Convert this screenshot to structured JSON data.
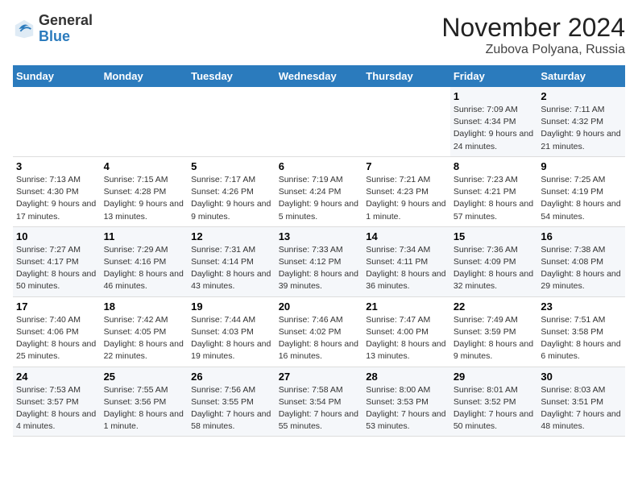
{
  "logo": {
    "general": "General",
    "blue": "Blue"
  },
  "header": {
    "month": "November 2024",
    "location": "Zubova Polyana, Russia"
  },
  "weekdays": [
    "Sunday",
    "Monday",
    "Tuesday",
    "Wednesday",
    "Thursday",
    "Friday",
    "Saturday"
  ],
  "weeks": [
    [
      {
        "day": "",
        "info": ""
      },
      {
        "day": "",
        "info": ""
      },
      {
        "day": "",
        "info": ""
      },
      {
        "day": "",
        "info": ""
      },
      {
        "day": "",
        "info": ""
      },
      {
        "day": "1",
        "info": "Sunrise: 7:09 AM\nSunset: 4:34 PM\nDaylight: 9 hours and 24 minutes."
      },
      {
        "day": "2",
        "info": "Sunrise: 7:11 AM\nSunset: 4:32 PM\nDaylight: 9 hours and 21 minutes."
      }
    ],
    [
      {
        "day": "3",
        "info": "Sunrise: 7:13 AM\nSunset: 4:30 PM\nDaylight: 9 hours and 17 minutes."
      },
      {
        "day": "4",
        "info": "Sunrise: 7:15 AM\nSunset: 4:28 PM\nDaylight: 9 hours and 13 minutes."
      },
      {
        "day": "5",
        "info": "Sunrise: 7:17 AM\nSunset: 4:26 PM\nDaylight: 9 hours and 9 minutes."
      },
      {
        "day": "6",
        "info": "Sunrise: 7:19 AM\nSunset: 4:24 PM\nDaylight: 9 hours and 5 minutes."
      },
      {
        "day": "7",
        "info": "Sunrise: 7:21 AM\nSunset: 4:23 PM\nDaylight: 9 hours and 1 minute."
      },
      {
        "day": "8",
        "info": "Sunrise: 7:23 AM\nSunset: 4:21 PM\nDaylight: 8 hours and 57 minutes."
      },
      {
        "day": "9",
        "info": "Sunrise: 7:25 AM\nSunset: 4:19 PM\nDaylight: 8 hours and 54 minutes."
      }
    ],
    [
      {
        "day": "10",
        "info": "Sunrise: 7:27 AM\nSunset: 4:17 PM\nDaylight: 8 hours and 50 minutes."
      },
      {
        "day": "11",
        "info": "Sunrise: 7:29 AM\nSunset: 4:16 PM\nDaylight: 8 hours and 46 minutes."
      },
      {
        "day": "12",
        "info": "Sunrise: 7:31 AM\nSunset: 4:14 PM\nDaylight: 8 hours and 43 minutes."
      },
      {
        "day": "13",
        "info": "Sunrise: 7:33 AM\nSunset: 4:12 PM\nDaylight: 8 hours and 39 minutes."
      },
      {
        "day": "14",
        "info": "Sunrise: 7:34 AM\nSunset: 4:11 PM\nDaylight: 8 hours and 36 minutes."
      },
      {
        "day": "15",
        "info": "Sunrise: 7:36 AM\nSunset: 4:09 PM\nDaylight: 8 hours and 32 minutes."
      },
      {
        "day": "16",
        "info": "Sunrise: 7:38 AM\nSunset: 4:08 PM\nDaylight: 8 hours and 29 minutes."
      }
    ],
    [
      {
        "day": "17",
        "info": "Sunrise: 7:40 AM\nSunset: 4:06 PM\nDaylight: 8 hours and 25 minutes."
      },
      {
        "day": "18",
        "info": "Sunrise: 7:42 AM\nSunset: 4:05 PM\nDaylight: 8 hours and 22 minutes."
      },
      {
        "day": "19",
        "info": "Sunrise: 7:44 AM\nSunset: 4:03 PM\nDaylight: 8 hours and 19 minutes."
      },
      {
        "day": "20",
        "info": "Sunrise: 7:46 AM\nSunset: 4:02 PM\nDaylight: 8 hours and 16 minutes."
      },
      {
        "day": "21",
        "info": "Sunrise: 7:47 AM\nSunset: 4:00 PM\nDaylight: 8 hours and 13 minutes."
      },
      {
        "day": "22",
        "info": "Sunrise: 7:49 AM\nSunset: 3:59 PM\nDaylight: 8 hours and 9 minutes."
      },
      {
        "day": "23",
        "info": "Sunrise: 7:51 AM\nSunset: 3:58 PM\nDaylight: 8 hours and 6 minutes."
      }
    ],
    [
      {
        "day": "24",
        "info": "Sunrise: 7:53 AM\nSunset: 3:57 PM\nDaylight: 8 hours and 4 minutes."
      },
      {
        "day": "25",
        "info": "Sunrise: 7:55 AM\nSunset: 3:56 PM\nDaylight: 8 hours and 1 minute."
      },
      {
        "day": "26",
        "info": "Sunrise: 7:56 AM\nSunset: 3:55 PM\nDaylight: 7 hours and 58 minutes."
      },
      {
        "day": "27",
        "info": "Sunrise: 7:58 AM\nSunset: 3:54 PM\nDaylight: 7 hours and 55 minutes."
      },
      {
        "day": "28",
        "info": "Sunrise: 8:00 AM\nSunset: 3:53 PM\nDaylight: 7 hours and 53 minutes."
      },
      {
        "day": "29",
        "info": "Sunrise: 8:01 AM\nSunset: 3:52 PM\nDaylight: 7 hours and 50 minutes."
      },
      {
        "day": "30",
        "info": "Sunrise: 8:03 AM\nSunset: 3:51 PM\nDaylight: 7 hours and 48 minutes."
      }
    ]
  ]
}
